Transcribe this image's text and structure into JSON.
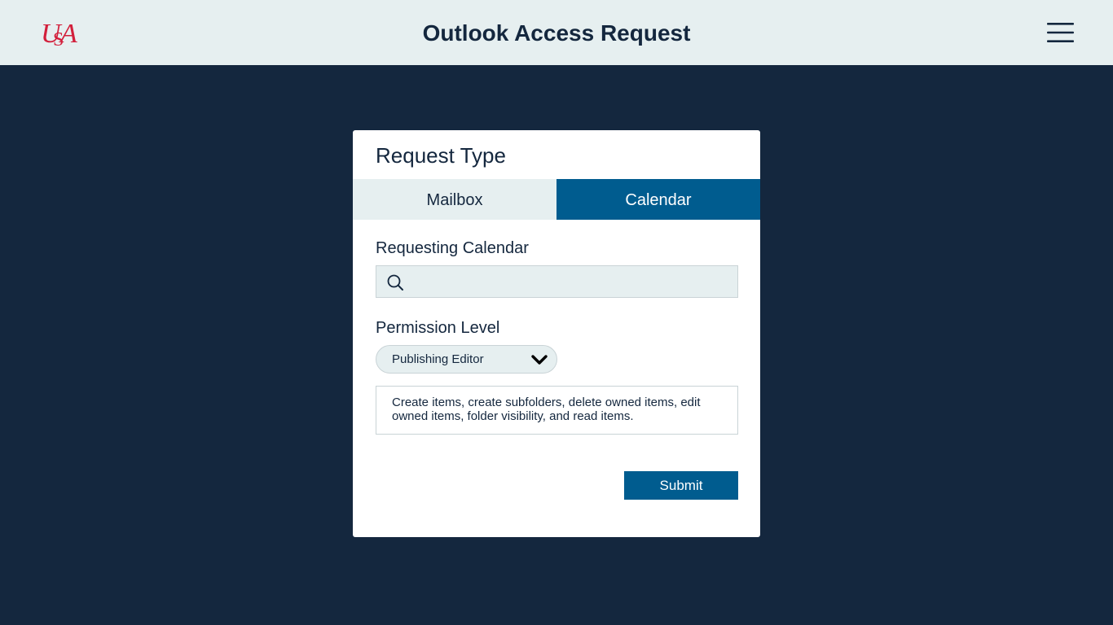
{
  "header": {
    "logo_text": "USA",
    "title": "Outlook Access Request",
    "menu_icon": "hamburger-menu-icon"
  },
  "colors": {
    "page_background": "#14273e",
    "header_background": "#e6eff0",
    "accent": "#005c8f",
    "logo_red": "#d21f3b",
    "text_dark": "#14273e"
  },
  "card": {
    "title": "Request Type",
    "tabs": [
      {
        "label": "Mailbox",
        "active": false
      },
      {
        "label": "Calendar",
        "active": true
      }
    ],
    "requesting_calendar": {
      "label": "Requesting Calendar",
      "value": "",
      "icon": "search-icon"
    },
    "permission_level": {
      "label": "Permission Level",
      "selected": "Publishing Editor",
      "icon": "chevron-down-icon"
    },
    "permission_description": "Create items, create subfolders, delete owned items, edit owned items, folder visibility, and read items.",
    "submit_label": "Submit"
  }
}
